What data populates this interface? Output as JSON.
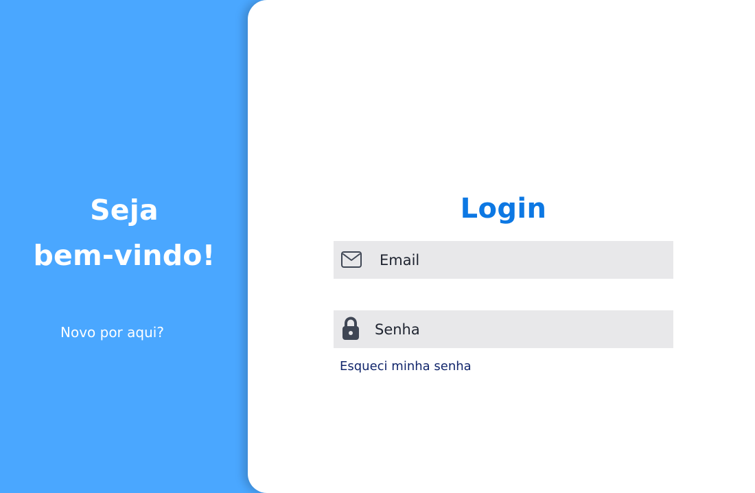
{
  "welcome_panel": {
    "title_line_1": "Seja",
    "title_line_2": "bem-vindo!",
    "new_here_label": "Novo por aqui?"
  },
  "login_card": {
    "title": "Login",
    "email": {
      "icon": "envelope-icon",
      "placeholder": "Email",
      "value": ""
    },
    "password": {
      "icon": "lock-icon",
      "placeholder": "Senha",
      "value": ""
    },
    "forgot_password_label": "Esqueci minha senha"
  },
  "colors": {
    "left_panel_background": "#4aa7ff",
    "card_background": "#ffffff",
    "login_title": "#0d78e3",
    "field_background": "#e8e8ea",
    "field_text": "#1f2430",
    "forgot_link": "#10256b"
  }
}
